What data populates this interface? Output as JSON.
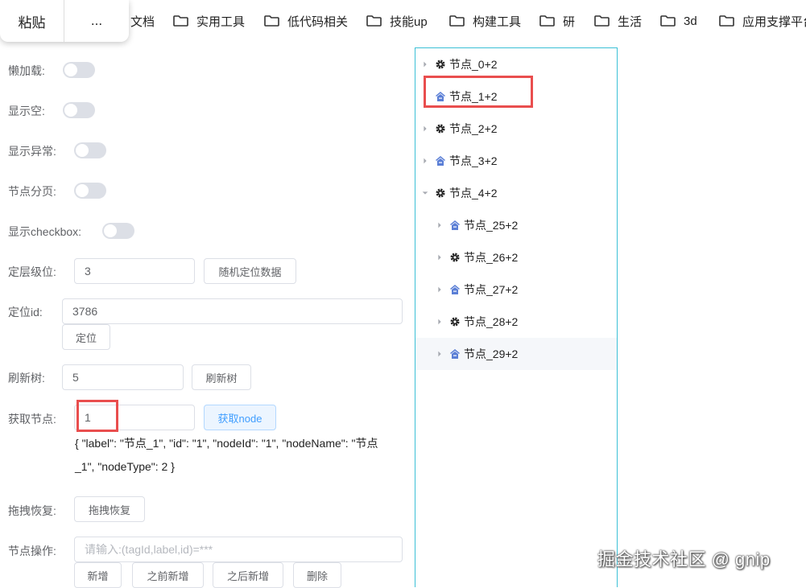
{
  "bookmarks": {
    "popup": {
      "paste_label": "粘贴",
      "more_label": "..."
    },
    "items": [
      {
        "label": "文档",
        "has_folder": false
      },
      {
        "label": "实用工具",
        "has_folder": true
      },
      {
        "label": "低代码相关",
        "has_folder": true
      },
      {
        "label": "技能up",
        "has_folder": true
      },
      {
        "label": "构建工具",
        "has_folder": true
      },
      {
        "label": "研",
        "has_folder": true
      },
      {
        "label": "生活",
        "has_folder": true
      },
      {
        "label": "3d",
        "has_folder": true
      },
      {
        "label": "应用支撑平台",
        "has_folder": true
      }
    ]
  },
  "form": {
    "lazy_label": "懒加载:",
    "show_empty_label": "显示空:",
    "show_error_label": "显示异常:",
    "node_paging_label": "节点分页:",
    "show_checkbox_label": "显示checkbox:",
    "locate_level_label": "定层级位:",
    "locate_level_value": "3",
    "random_locate_button": "随机定位数据",
    "locate_id_label": "定位id:",
    "locate_id_value": "3786",
    "locate_button": "定位",
    "refresh_tree_label": "刷新树:",
    "refresh_tree_value": "5",
    "refresh_tree_button": "刷新树",
    "get_node_label": "获取节点:",
    "get_node_value": "1",
    "get_node_button": "获取node",
    "get_node_result_line1": "{ \"label\": \"节点_1\", \"id\": \"1\", \"nodeId\": \"1\", \"nodeName\": \"节点",
    "get_node_result_line2": "_1\", \"nodeType\": 2 }",
    "drag_restore_label": "拖拽恢复:",
    "drag_restore_button": "拖拽恢复",
    "node_op_label": "节点操作:",
    "node_op_placeholder": "请输入:(tagId,label,id)=***",
    "add_button": "新增",
    "insert_before_button": "之前新增",
    "insert_after_button": "之后新增",
    "delete_button": "删除"
  },
  "tree": {
    "nodes": [
      {
        "label": "节点_0+2",
        "icon": "gear-icon",
        "level": 0,
        "caret": "right"
      },
      {
        "label": "节点_1+2",
        "icon": "house-icon",
        "level": 0,
        "caret": "none"
      },
      {
        "label": "节点_2+2",
        "icon": "gear-icon",
        "level": 0,
        "caret": "right"
      },
      {
        "label": "节点_3+2",
        "icon": "house-icon",
        "level": 0,
        "caret": "right"
      },
      {
        "label": "节点_4+2",
        "icon": "gear-icon",
        "level": 0,
        "caret": "down"
      },
      {
        "label": "节点_25+2",
        "icon": "house-icon",
        "level": 1,
        "caret": "right"
      },
      {
        "label": "节点_26+2",
        "icon": "gear-icon",
        "level": 1,
        "caret": "right"
      },
      {
        "label": "节点_27+2",
        "icon": "house-icon",
        "level": 1,
        "caret": "right"
      },
      {
        "label": "节点_28+2",
        "icon": "gear-icon",
        "level": 1,
        "caret": "right"
      },
      {
        "label": "节点_29+2",
        "icon": "house-icon",
        "level": 1,
        "caret": "right",
        "hovered": true
      }
    ]
  },
  "watermark": "掘金技术社区 @ gnip",
  "colors": {
    "accent": "#409eff",
    "highlight": "#e94e4e",
    "panel_border": "#3bc0d6",
    "house_icon": "#5b7fd6"
  }
}
